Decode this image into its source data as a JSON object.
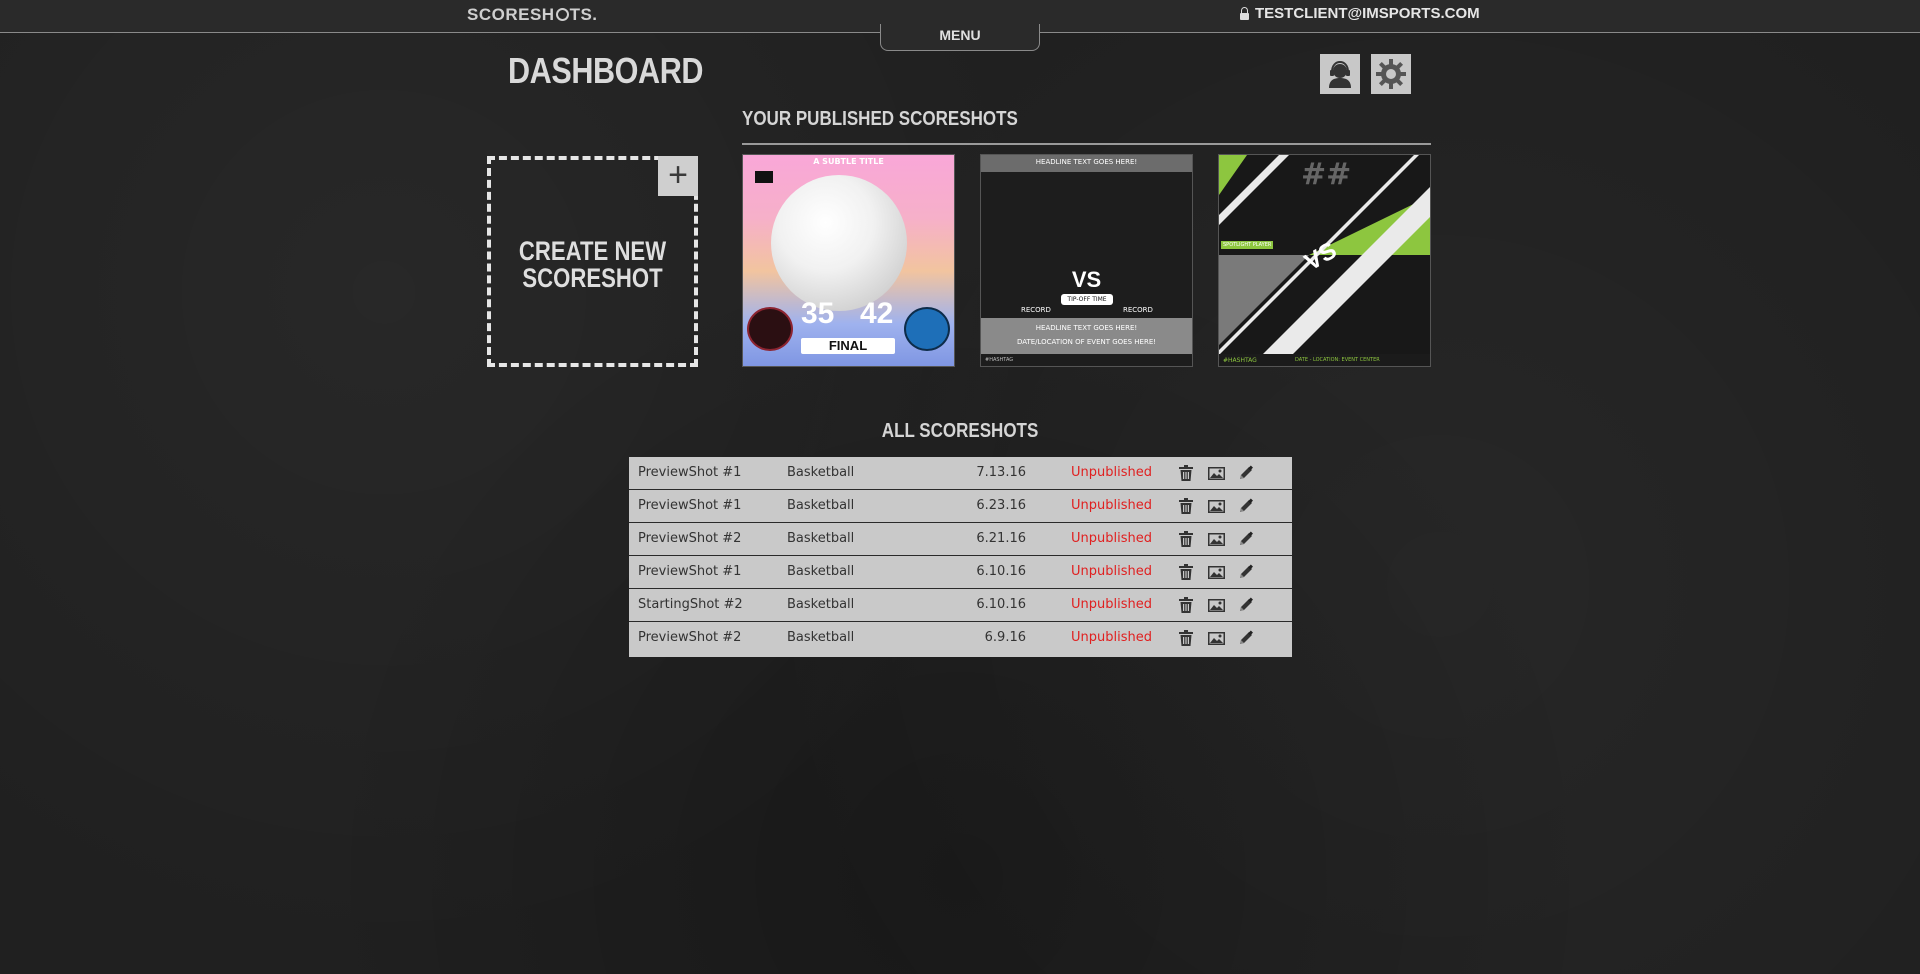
{
  "header": {
    "logo_text_left": "SCORESH",
    "logo_text_right": "TS.",
    "user_email": "TESTCLIENT@IMSPORTS.COM",
    "menu_label": "MENU"
  },
  "page": {
    "title": "DASHBOARD"
  },
  "published": {
    "heading": "YOUR PUBLISHED SCORESHOTS",
    "create_label_line1": "CREATE NEW",
    "create_label_line2": "SCORESHOT",
    "create_plus": "+",
    "thumb1": {
      "title": "A SUBTLE TITLE",
      "score_left": "35",
      "score_right": "42",
      "status": "FINAL"
    },
    "thumb2": {
      "headline_top": "HEADLINE TEXT GOES HERE!",
      "vs": "VS",
      "tipoff": "TIP-OFF TIME",
      "record_left": "RECORD",
      "record_right": "RECORD",
      "headline_bottom": "HEADLINE TEXT GOES HERE!",
      "date_location": "DATE/LOCATION OF EVENT GOES HERE!",
      "hashtag": "#HASHTAG"
    },
    "thumb3": {
      "number": "##",
      "vs": "VS",
      "spotlight": "SPOTLIGHT PLAYER",
      "hashtag": "#HASHTAG",
      "date_location": "DATE - LOCATION: EVENT CENTER"
    }
  },
  "all": {
    "heading": "ALL SCORESHOTS",
    "rows": [
      {
        "name": "PreviewShot #1",
        "sport": "Basketball",
        "date": "7.13.16",
        "status": "Unpublished"
      },
      {
        "name": "PreviewShot #1",
        "sport": "Basketball",
        "date": "6.23.16",
        "status": "Unpublished"
      },
      {
        "name": "PreviewShot #2",
        "sport": "Basketball",
        "date": "6.21.16",
        "status": "Unpublished"
      },
      {
        "name": "PreviewShot #1",
        "sport": "Basketball",
        "date": "6.10.16",
        "status": "Unpublished"
      },
      {
        "name": "StartingShot #2",
        "sport": "Basketball",
        "date": "6.10.16",
        "status": "Unpublished"
      },
      {
        "name": "PreviewShot #2",
        "sport": "Basketball",
        "date": "6.9.16",
        "status": "Unpublished"
      }
    ]
  },
  "colors": {
    "accent_green": "#8dc63f",
    "status_red": "#e02020",
    "row_bg": "#c9c9c9"
  },
  "icons": [
    "lock-icon",
    "support-headset-icon",
    "gear-icon",
    "plus-icon",
    "trash-icon",
    "image-icon",
    "edit-pen-icon"
  ]
}
